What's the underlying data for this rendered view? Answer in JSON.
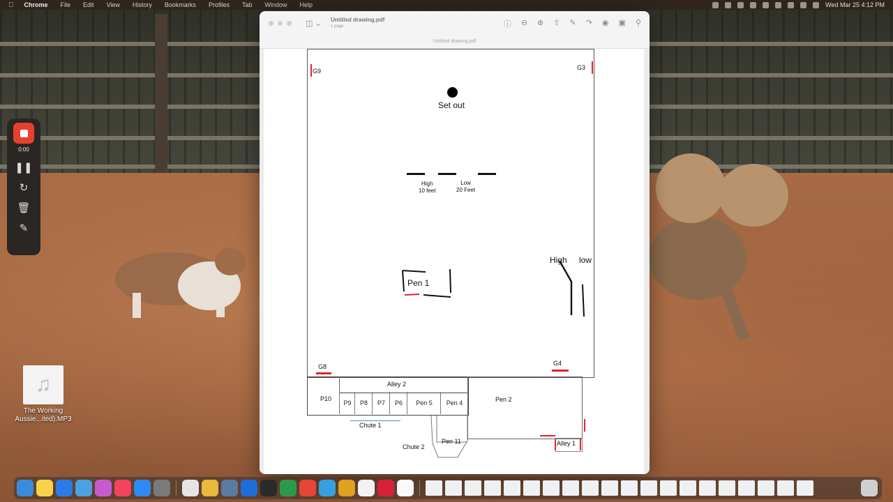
{
  "menubar": {
    "app_name": "Chrome",
    "menus": [
      "File",
      "Edit",
      "View",
      "History",
      "Bookmarks",
      "Profiles",
      "Tab",
      "Window",
      "Help"
    ],
    "clock": "Wed Mar 25  4:12 PM"
  },
  "recorder": {
    "time": "0:00"
  },
  "desktop_file": {
    "name": "The Working Aussie...ited).MP3"
  },
  "preview": {
    "doc_title": "Untitled drawing.pdf",
    "doc_pages": "1 page",
    "tab_name": "Untitled drawing.pdf"
  },
  "drawing": {
    "g9": "G9",
    "g3": "G3",
    "set_out": "Set out",
    "high_10": "High\n10 feet",
    "low_20": "Low\n20 Feet",
    "pen1": "Pen 1",
    "high": "High",
    "low": "low",
    "g8": "G8",
    "g4": "G4",
    "alley2": "Alley 2",
    "p10": "P10",
    "pens_row": [
      "P9",
      "P8",
      "P7",
      "P6",
      "Pen 5",
      "Pen 4"
    ],
    "pen2": "Pen 2",
    "chute1": "Chute 1",
    "pen11": "Pen 11",
    "chute2": "Chute 2",
    "alley1": "Alley 1"
  },
  "colors": {
    "gate_red": "#e8202a",
    "record_red": "#e8402f"
  }
}
